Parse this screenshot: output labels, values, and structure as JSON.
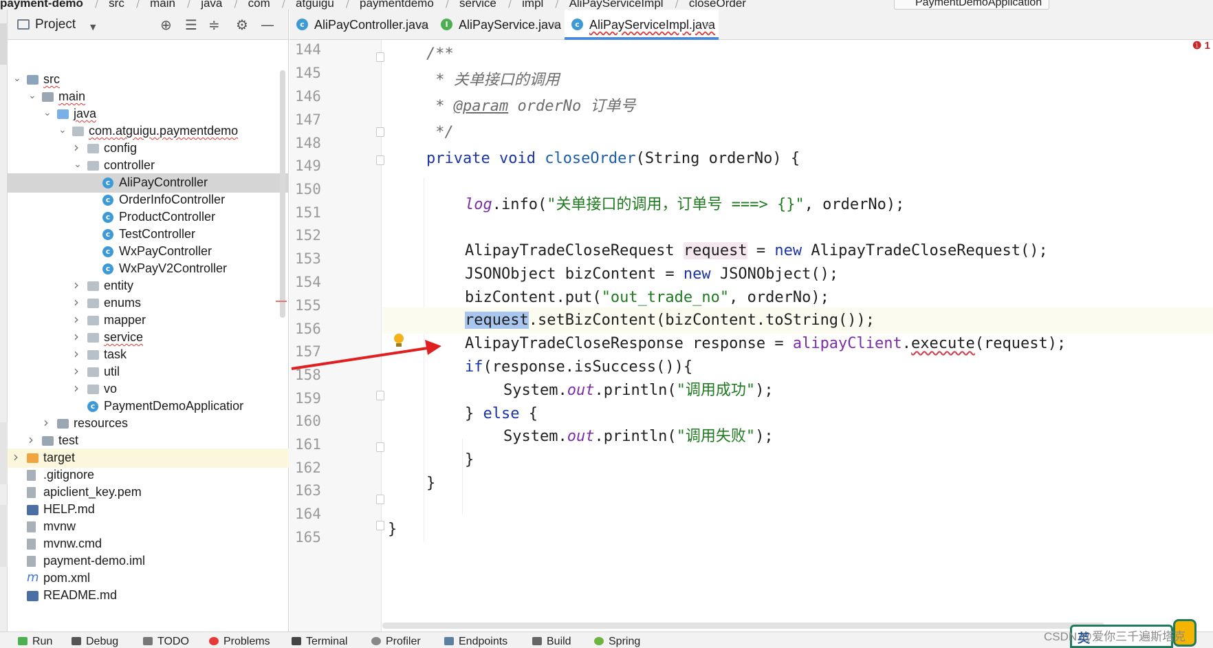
{
  "breadcrumb": {
    "project": "payment-demo",
    "items": [
      "src",
      "main",
      "java",
      "com",
      "atguigu",
      "paymentdemo",
      "service",
      "impl",
      "AliPayServiceImpl",
      "closeOrder"
    ],
    "run_config": "PaymentDemoApplication"
  },
  "project_panel": {
    "title": "Project",
    "tree": [
      {
        "label": "src",
        "depth": 1,
        "expanded": true,
        "icon": "folder-src-icon"
      },
      {
        "label": "main",
        "depth": 2,
        "expanded": true,
        "icon": "folder-icon"
      },
      {
        "label": "java",
        "depth": 3,
        "expanded": true,
        "icon": "folder-source-root-icon"
      },
      {
        "label": "com.atguigu.paymentdemo",
        "depth": 4,
        "expanded": true,
        "icon": "package-icon"
      },
      {
        "label": "config",
        "depth": 5,
        "expanded": false,
        "icon": "package-icon"
      },
      {
        "label": "controller",
        "depth": 5,
        "expanded": true,
        "icon": "package-icon"
      },
      {
        "label": "AliPayController",
        "depth": 6,
        "icon": "class-icon",
        "selected": true
      },
      {
        "label": "OrderInfoController",
        "depth": 6,
        "icon": "class-icon"
      },
      {
        "label": "ProductController",
        "depth": 6,
        "icon": "class-icon"
      },
      {
        "label": "TestController",
        "depth": 6,
        "icon": "class-icon"
      },
      {
        "label": "WxPayController",
        "depth": 6,
        "icon": "class-icon"
      },
      {
        "label": "WxPayV2Controller",
        "depth": 6,
        "icon": "class-icon"
      },
      {
        "label": "entity",
        "depth": 5,
        "expanded": false,
        "icon": "package-icon"
      },
      {
        "label": "enums",
        "depth": 5,
        "expanded": false,
        "icon": "package-icon"
      },
      {
        "label": "mapper",
        "depth": 5,
        "expanded": false,
        "icon": "package-icon"
      },
      {
        "label": "service",
        "depth": 5,
        "expanded": false,
        "icon": "package-icon"
      },
      {
        "label": "task",
        "depth": 5,
        "expanded": false,
        "icon": "package-icon"
      },
      {
        "label": "util",
        "depth": 5,
        "expanded": false,
        "icon": "package-icon"
      },
      {
        "label": "vo",
        "depth": 5,
        "expanded": false,
        "icon": "package-icon"
      },
      {
        "label": "PaymentDemoApplicatior",
        "depth": 5,
        "icon": "spring-app-class-icon"
      },
      {
        "label": "resources",
        "depth": 3,
        "expanded": false,
        "icon": "resources-folder-icon"
      },
      {
        "label": "test",
        "depth": 2,
        "expanded": false,
        "icon": "folder-icon"
      },
      {
        "label": "target",
        "depth": 1,
        "expanded": false,
        "icon": "folder-excluded-icon"
      },
      {
        "label": ".gitignore",
        "depth": 1,
        "icon": "file-icon"
      },
      {
        "label": "apiclient_key.pem",
        "depth": 1,
        "icon": "file-icon"
      },
      {
        "label": "HELP.md",
        "depth": 1,
        "icon": "markdown-file-icon"
      },
      {
        "label": "mvnw",
        "depth": 1,
        "icon": "file-icon"
      },
      {
        "label": "mvnw.cmd",
        "depth": 1,
        "icon": "file-icon"
      },
      {
        "label": "payment-demo.iml",
        "depth": 1,
        "icon": "file-icon"
      },
      {
        "label": "pom.xml",
        "depth": 1,
        "icon": "maven-file-icon"
      },
      {
        "label": "README.md",
        "depth": 1,
        "icon": "markdown-file-icon"
      }
    ]
  },
  "editor": {
    "tabs": [
      {
        "label": "AliPayController.java",
        "icon": "class-icon",
        "active": false
      },
      {
        "label": "AliPayService.java",
        "icon": "interface-icon",
        "active": false
      },
      {
        "label": "AliPayServiceImpl.java",
        "icon": "class-icon",
        "active": true
      }
    ],
    "error_indicator": "1",
    "line_numbers": [
      "144",
      "145",
      "146",
      "147",
      "148",
      "149",
      "150",
      "151",
      "152",
      "153",
      "154",
      "155",
      "156",
      "157",
      "158",
      "159",
      "160",
      "161",
      "162",
      "163",
      "164",
      "165"
    ],
    "code": {
      "l144": "/**",
      "l145_star": " * ",
      "l145_text": "关单接口的调用",
      "l146_star": " * ",
      "l146_tag": "@param",
      "l146_name": " orderNo ",
      "l146_text": "订单号",
      "l147": " */",
      "l148_kw1": "private",
      "l148_kw2": " void",
      "l148_name": " closeOrder",
      "l148_rest": "(String orderNo) {",
      "l150_field": "log",
      "l150_call": ".info(",
      "l150_str": "\"关单接口的调用，订单号 ===> {}\"",
      "l150_rest": ", orderNo);",
      "l152_type": "AlipayTradeCloseRequest ",
      "l152_var": "request",
      "l152_eq": " = ",
      "l152_kw": "new",
      "l152_rest": " AlipayTradeCloseRequest();",
      "l153_a": "JSONObject bizContent = ",
      "l153_kw": "new",
      "l153_b": " JSONObject();",
      "l154_a": "bizContent.put(",
      "l154_str": "\"out_trade_no\"",
      "l154_b": ", orderNo);",
      "l155_sel": "request",
      "l155_rest": ".setBizContent(bizContent.toString());",
      "l156_a": "AlipayTradeCloseResponse response = ",
      "l156_field": "alipayClient",
      "l156_dot": ".",
      "l156_sq": "execute",
      "l156_b": "(request);",
      "l157_kw": "if",
      "l157_rest": "(response.isSuccess()){",
      "l158_a": "System.",
      "l158_out": "out",
      "l158_b": ".println(",
      "l158_str": "\"调用成功\"",
      "l158_c": ");",
      "l159_a": "} ",
      "l159_kw": "else",
      "l159_b": " {",
      "l160_a": "System.",
      "l160_out": "out",
      "l160_b": ".println(",
      "l160_str": "\"调用失败\"",
      "l160_c": ");",
      "l161": "}",
      "l162": "}",
      "l164": "}"
    }
  },
  "bottom_bar": {
    "items": [
      "Run",
      "Debug",
      "TODO",
      "Problems",
      "Terminal",
      "Profiler",
      "Endpoints",
      "Build",
      "Spring"
    ]
  },
  "watermark": "CSDN @爱你三千遍斯塔克",
  "ime": {
    "label": "英"
  },
  "colors": {
    "keyword": "#1a33a6",
    "string": "#1f7a1f",
    "field": "#7b2ea4",
    "method": "#1c5da8",
    "comment": "#6b6b6b",
    "selection": "#a9c7ee",
    "tab_underline": "#4a88d8",
    "annotation_arrow": "#e02020"
  }
}
